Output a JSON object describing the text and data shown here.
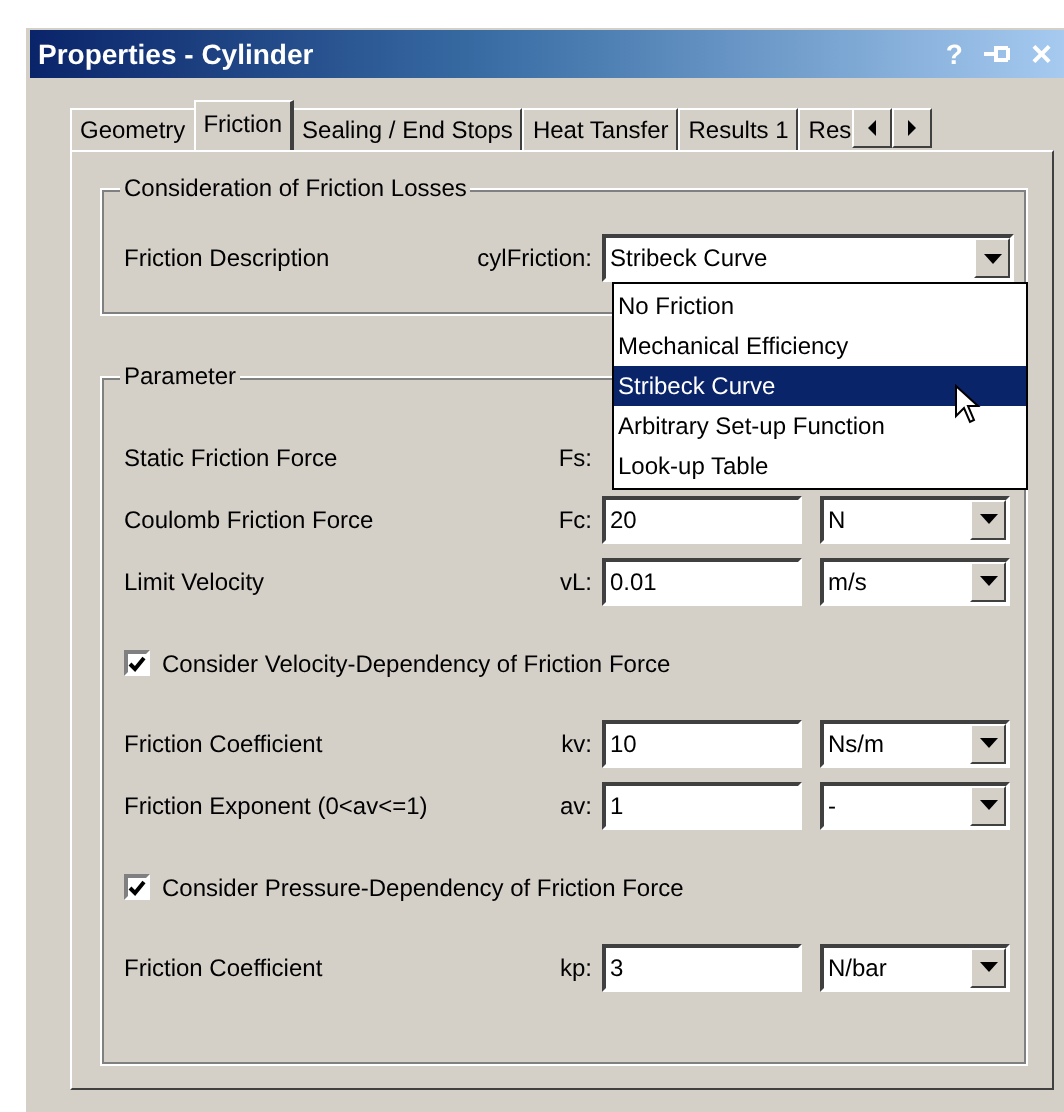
{
  "window": {
    "title": "Properties - Cylinder",
    "help": "?",
    "close": "×"
  },
  "tabs": [
    {
      "label": "Geometry",
      "selected": false
    },
    {
      "label": "Friction",
      "selected": true
    },
    {
      "label": "Sealing / End Stops",
      "selected": false
    },
    {
      "label": "Heat Tansfer",
      "selected": false
    },
    {
      "label": "Results 1",
      "selected": false
    },
    {
      "label": "Res",
      "selected": false
    }
  ],
  "friction_losses": {
    "title": "Consideration of Friction Losses",
    "label": "Friction Description",
    "symbol": "cylFriction:",
    "value": "Stribeck Curve",
    "options": [
      {
        "label": "No Friction",
        "selected": false
      },
      {
        "label": "Mechanical Efficiency",
        "selected": false
      },
      {
        "label": "Stribeck Curve",
        "selected": true
      },
      {
        "label": "Arbitrary Set-up Function",
        "selected": false
      },
      {
        "label": "Look-up Table",
        "selected": false
      }
    ]
  },
  "parameter": {
    "title": "Parameter",
    "rows": [
      {
        "kind": "field",
        "label": "Static Friction Force",
        "symbol": "Fs:"
      },
      {
        "kind": "field",
        "label": "Coulomb Friction Force",
        "symbol": "Fc:",
        "value": "20",
        "unit": "N"
      },
      {
        "kind": "field",
        "label": "Limit Velocity",
        "symbol": "vL:",
        "value": "0.01",
        "unit": "m/s"
      },
      {
        "kind": "checkbox",
        "label": "Consider Velocity-Dependency of Friction Force",
        "checked": true
      },
      {
        "kind": "field",
        "label": "Friction Coefficient",
        "symbol": "kv:",
        "value": "10",
        "unit": "Ns/m"
      },
      {
        "kind": "field",
        "label": "Friction Exponent (0<av<=1)",
        "symbol": "av:",
        "value": "1",
        "unit": "-"
      },
      {
        "kind": "checkbox",
        "label": "Consider Pressure-Dependency of Friction Force",
        "checked": true
      },
      {
        "kind": "field",
        "label": "Friction Coefficient",
        "symbol": "kp:",
        "value": "3",
        "unit": "N/bar"
      }
    ]
  }
}
